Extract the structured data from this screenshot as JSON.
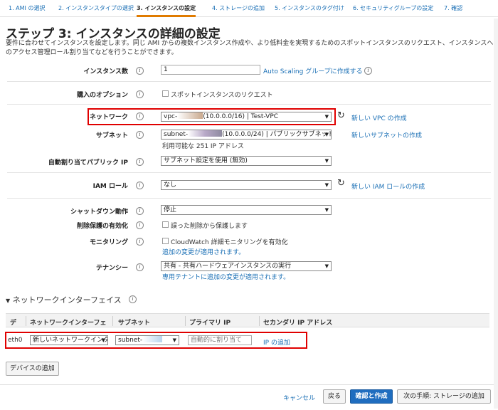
{
  "tabs": [
    {
      "label": "1. AMI の選択"
    },
    {
      "label": "2. インスタンスタイプの選択"
    },
    {
      "label": "3. インスタンスの設定"
    },
    {
      "label": "4. ストレージの追加"
    },
    {
      "label": "5. インスタンスのタグ付け"
    },
    {
      "label": "6. セキュリティグループの設定"
    },
    {
      "label": "7. 確認"
    }
  ],
  "page": {
    "title": "ステップ 3: インスタンスの詳細の設定",
    "description": "要件に合わせてインスタンスを設定します。同じ AMI からの複数インスタンス作成や、より低料金を実現するためのスポットインスタンスのリクエスト、インスタンスへのアクセス管理ロール割り当てなどを行うことができます。"
  },
  "form": {
    "instance_count": {
      "label": "インスタンス数",
      "value": "1",
      "link": "Auto Scaling グループに作成する"
    },
    "purchase_option": {
      "label": "購入のオプション",
      "checkbox": "スポットインスタンスのリクエスト"
    },
    "network": {
      "label": "ネットワーク",
      "prefix": "vpc-",
      "suffix": "(10.0.0.0/16) | Test-VPC",
      "link": "新しい VPC の作成"
    },
    "subnet": {
      "label": "サブネット",
      "prefix": "subnet-",
      "suffix": "(10.0.0.0/24) | パブリックサブネット",
      "link": "新しいサブネットの作成",
      "hint": "利用可能な 251 IP アドレス"
    },
    "public_ip": {
      "label": "自動割り当てパブリック IP",
      "value": "サブネット設定を使用 (無効)"
    },
    "iam_role": {
      "label": "IAM ロール",
      "value": "なし",
      "link": "新しい IAM ロールの作成"
    },
    "shutdown": {
      "label": "シャットダウン動作",
      "value": "停止"
    },
    "termination_protection": {
      "label": "削除保護の有効化",
      "checkbox": "誤った削除から保護します"
    },
    "monitoring": {
      "label": "モニタリング",
      "checkbox": "CloudWatch 詳細モニタリングを有効化",
      "note": "追加の変更が適用されます。"
    },
    "tenancy": {
      "label": "テナンシー",
      "value": "共有 - 共有ハードウェアインスタンスの実行",
      "note": "専用テナントに追加の変更が適用されます。"
    }
  },
  "network_interfaces": {
    "title": "ネットワークインターフェイス",
    "columns": [
      "デ",
      "ネットワークインターフェ",
      "サブネット",
      "プライマリ IP",
      "セカンダリ IP アドレス"
    ],
    "row": {
      "device": "eth0",
      "interface": "新しいネットワークインタ",
      "subnet_prefix": "subnet-",
      "primary_ip_placeholder": "自動的に割り当て",
      "add_ip_link": "IP の追加"
    },
    "add_device_button": "デバイスの追加"
  },
  "footer": {
    "cancel": "キャンセル",
    "back": "戻る",
    "review": "確認と作成",
    "next": "次の手順: ストレージの追加"
  },
  "colors": {
    "link": "#1a6fb5",
    "primary_button": "#1f6dbf",
    "active_tab_underline": "#e07b00",
    "highlight_box": "#e00000"
  }
}
